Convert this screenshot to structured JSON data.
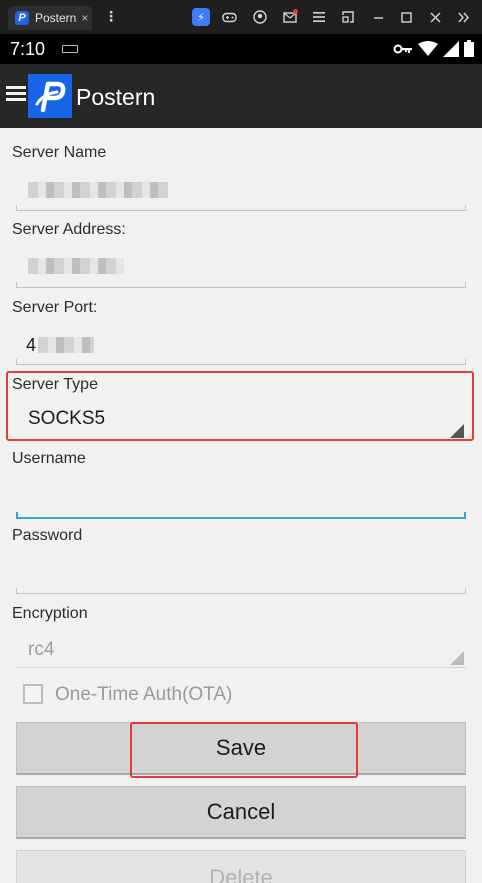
{
  "emulator": {
    "tab_title": "Postern",
    "tab_icon_letter": "P",
    "tab_close": "×",
    "menu_glyph": "⋮",
    "controls": [
      "boost-icon",
      "gamepad-icon",
      "account-icon",
      "mail-icon",
      "menu-icon",
      "screen-icon",
      "minimize-icon",
      "maximize-icon",
      "close-icon",
      "expand-icon"
    ]
  },
  "status": {
    "time": "7:10"
  },
  "app": {
    "title": "Postern",
    "logo_letter": "P",
    "brand_color": "#1565e6"
  },
  "form": {
    "server_name_label": "Server Name",
    "server_address_label": "Server Address:",
    "server_port_label": "Server Port:",
    "server_port_first_char": "4",
    "server_type_label": "Server Type",
    "server_type_value": "SOCKS5",
    "username_label": "Username",
    "password_label": "Password",
    "encryption_label": "Encryption",
    "encryption_value": "rc4",
    "ota_label": "One-Time Auth(OTA)"
  },
  "buttons": {
    "save": "Save",
    "cancel": "Cancel",
    "delete": "Delete"
  },
  "colors": {
    "highlight": "#e53935",
    "focus_underline": "#34a8d9"
  }
}
